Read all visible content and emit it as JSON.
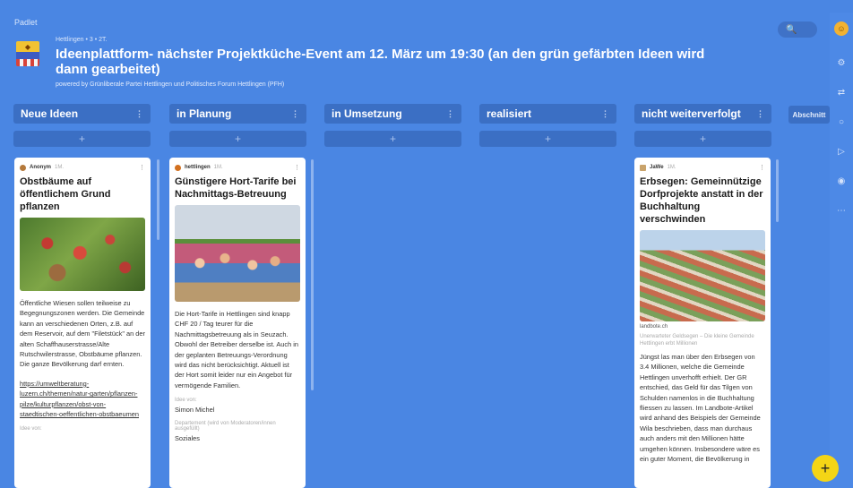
{
  "app": {
    "brand": "Padlet"
  },
  "header": {
    "breadcrumb": "Hettlingen • 3 • 2T.",
    "title": "Ideenplattform- nächster Projektküche-Event am 12. März um 19:30 (an den grün gefärbten Ideen wird dann gearbeitet)",
    "subtitle": "powered by Grünliberale Partei Hettlingen und Politisches Forum Hettlingen (PFH)",
    "search_icon": "🔍"
  },
  "columns": [
    {
      "label": "Neue Ideen",
      "more": "⋮"
    },
    {
      "label": "in Planung",
      "more": "⋮"
    },
    {
      "label": "in Umsetzung",
      "more": "⋮"
    },
    {
      "label": "realisiert",
      "more": "⋮"
    },
    {
      "label": "nicht weiterverfolgt",
      "more": "⋮"
    }
  ],
  "add_label": "+",
  "section_button": "Abschnitt",
  "cards": {
    "c1": {
      "author": "Anonym",
      "age": "1M.",
      "title": "Obstbäume auf öffentlichem Grund pflanzen",
      "text": "Öffentliche Wiesen sollen teilweise zu Begegnungszonen werden. Die Gemeinde kann an verschiedenen Orten, z.B. auf dem Reservoir, auf dem \"Filetstück\" an der alten Schaffhauserstrasse/Alte Rutschwilerstrasse, Obstbäume pflanzen. Die ganze Bevölkerung darf ernten.",
      "link": "https://umweltberatung-luzern.ch/themen/natur-garten/pflanzen-pilze/kulturpflanzen/obst-von-staedtischen-oeffentlichen-obstbaeumen",
      "field_label": "Idee von:"
    },
    "c2": {
      "author": "hettlingen",
      "age": "1M.",
      "title": "Günstigere Hort-Tarife bei Nachmittags-Betreuung",
      "text": "Die Hort-Tarife in Hettlingen sind knapp CHF 20 / Tag teurer für die Nachmittagsbetreuung als in Seuzach. Obwohl der Betreiber derselbe ist. Auch in der geplanten Betreuungs-Verordnung wird das nicht berücksichtigt. Aktuell ist der Hort somit leider nur ein Angebot für vermögende Familien.",
      "idea_label": "Idee von:",
      "idea_value": "Simon Michel",
      "dept_label": "Departement (wird von Moderatoren/innen ausgefüllt)",
      "dept_value": "Soziales"
    },
    "c3": {
      "author": "JaWe",
      "age": "1M.",
      "title": "Erbsegen: Gemeinnützige Dorfprojekte anstatt in der Buchhaltung verschwinden",
      "source": "landbote.ch",
      "caption": "Unerwarteter Geldsegen – Die kleine Gemeinde Hettlingen erbt Millionen",
      "text": "Jüngst las man über den Erbsegen von 3.4 Millionen, welche die Gemeinde Hettlingen unverhofft erhielt. Der GR entschied, das Geld für das Tilgen von Schulden namenlos in die Buchhaltung fliessen zu lassen. Im Landbote-Artikel wird anhand des Beispiels der Gemeinde Wila beschrieben, dass man durchaus auch anders mit den Millionen hätte umgehen können. Insbesondere wäre es ein guter Moment, die Bevölkerung in"
    }
  },
  "rail_icons": [
    "⚙",
    "⇄",
    "○",
    "▷",
    "◉",
    "⋯"
  ],
  "fab_label": "+",
  "colors": {
    "background": "#4a86e3",
    "column_header": "#3b6fc4",
    "fab": "#f4d516"
  }
}
